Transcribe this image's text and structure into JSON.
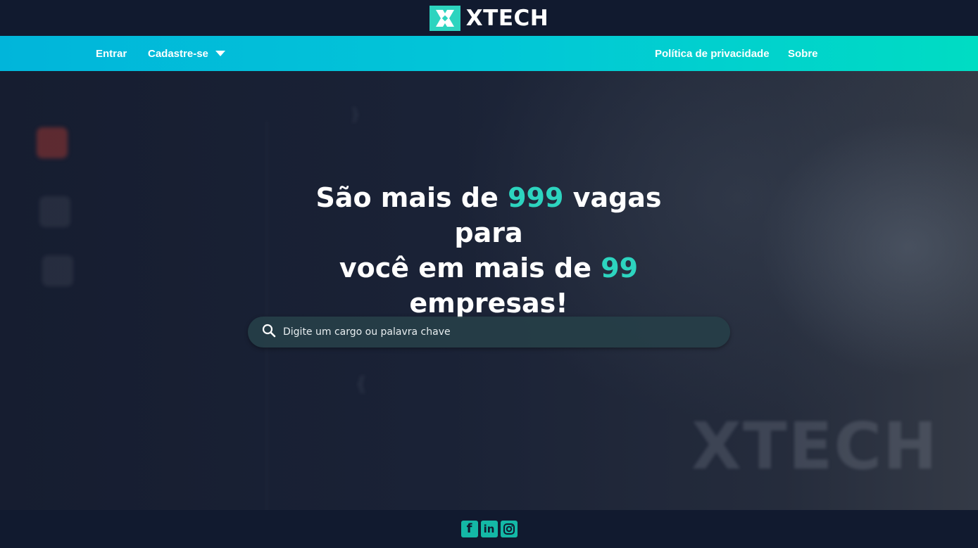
{
  "header": {
    "logo_text": "XTECH",
    "brand_color": "#2dd4bf"
  },
  "nav": {
    "entrar": "Entrar",
    "cadastre": "Cadastre-se",
    "privacy": "Política de privacidade",
    "sobre": "Sobre",
    "gradient": [
      "#01b5da",
      "#00dcc3"
    ]
  },
  "hero": {
    "line1_pre": "São mais de ",
    "vagas_count": "999",
    "line1_post": " vagas para",
    "line2_pre": "você em mais de ",
    "empresas_count": "99",
    "line3": "empresas!",
    "highlight_color": "#2dd4bf",
    "watermark": "XTECH"
  },
  "search": {
    "placeholder": "Digite um cargo ou palavra chave",
    "icon": "search-icon"
  },
  "footer": {
    "social": [
      {
        "name": "facebook-icon",
        "glyph": "f"
      },
      {
        "name": "linkedin-icon",
        "glyph": "in"
      },
      {
        "name": "instagram-icon",
        "glyph": ""
      }
    ]
  }
}
